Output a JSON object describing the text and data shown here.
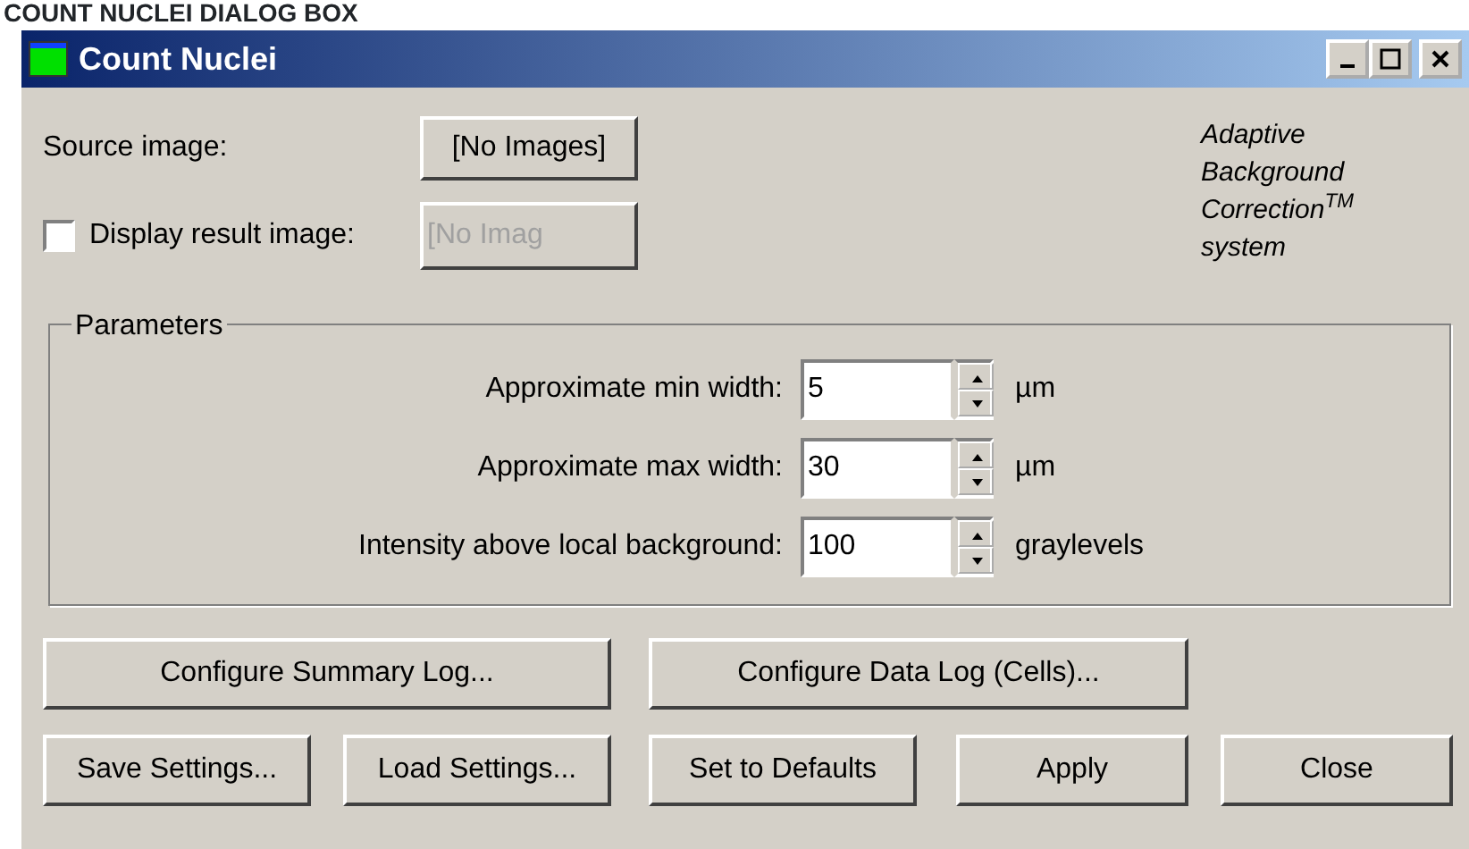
{
  "caption": "COUNT NUCLEI DIALOG BOX",
  "window": {
    "title": "Count Nuclei"
  },
  "source": {
    "label": "Source image:",
    "button": "[No Images]"
  },
  "display_result": {
    "label": "Display result image:",
    "checked": false,
    "button": "[No Imag",
    "disabled": true
  },
  "branding": [
    "Adaptive",
    "Background",
    "Correction$^{TM}$",
    "system"
  ],
  "parameters": {
    "title": "Parameters",
    "rows": [
      {
        "label": "Approximate min width:",
        "value": "5",
        "unit": "µm"
      },
      {
        "label": "Approximate max width:",
        "value": "30",
        "unit": "µm"
      },
      {
        "label": "Intensity above local background:",
        "value": "100",
        "unit": "graylevels"
      }
    ]
  },
  "log_buttons": [
    "Configure Summary Log...",
    "Configure Data Log (Cells)..."
  ],
  "buttons": [
    "Save Settings...",
    "Load Settings...",
    "Set to Defaults",
    "Apply",
    "Close"
  ]
}
